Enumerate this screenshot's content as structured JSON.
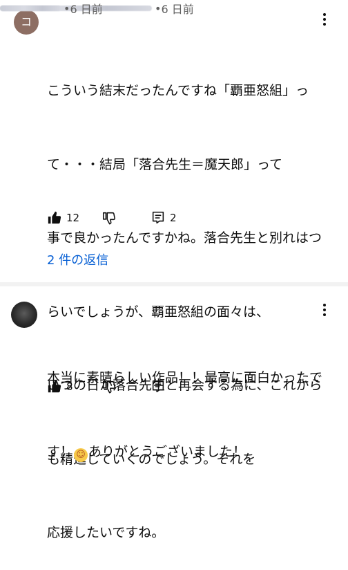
{
  "comments": [
    {
      "avatar_letter": "コ",
      "time": "6 日前",
      "lines": [
        "こういう結末だったんですね「覇亜怒組」っ",
        "て・・・結局「落合先生＝魔天郎」って",
        "事で良かったんですかね。落合先生と別れはつ",
        "らいでしょうが、覇亜怒組の面々は、",
        "いつの日か落合先生と再会する為に、これから",
        "も精進していくのでしょう。それを",
        "応援したいですね。"
      ],
      "like_count": "12",
      "reply_count": "2",
      "view_replies_label": "2 件の返信"
    },
    {
      "time": "6 日前",
      "line1": "本当に素晴らしい作品！！最高に面白かったで",
      "line2_before": "す！",
      "emoji": "☺",
      "line2_after": "ありがとうございました！",
      "like_count": "8"
    }
  ],
  "icons": {
    "like": "thumbs-up-icon",
    "dislike": "thumbs-down-icon",
    "reply": "reply-comment-icon",
    "more": "more-vert-icon"
  },
  "colors": {
    "link": "#065fd4",
    "meta": "#606060",
    "avatar_bg": "#8d6e63"
  }
}
